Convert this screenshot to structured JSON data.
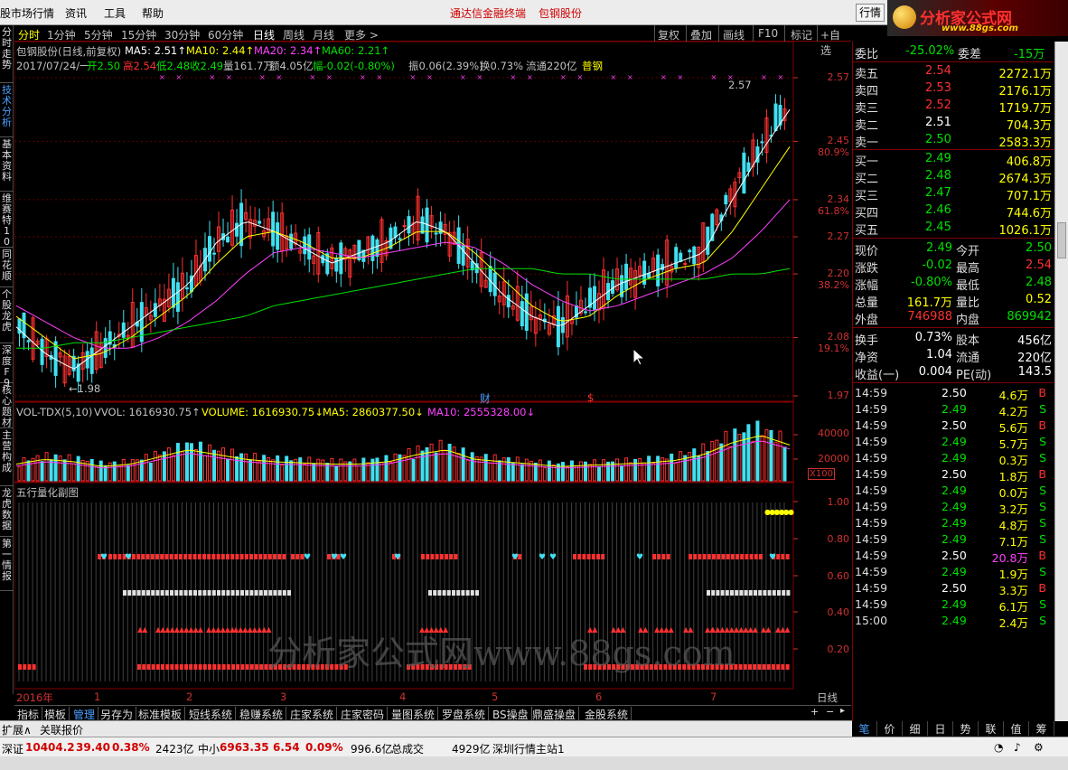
{
  "menubar": {
    "items": [
      "股市场行情",
      "资讯",
      "工具",
      "帮助"
    ],
    "center_title": "通达信金融终端",
    "stock_name": "包钢股份",
    "quote_button": "行情"
  },
  "logo": {
    "name": "分析家公式网",
    "url": "www.88gs.com"
  },
  "left_tabs": [
    "分时走势",
    "技术分析",
    "基本资料",
    "维赛特10",
    "同花顺",
    "个股龙虎",
    "深度F9",
    "核心题材",
    "主营构成",
    "龙虎数据",
    "第一情报"
  ],
  "period_tabs": [
    "分时",
    "1分钟",
    "5分钟",
    "15分钟",
    "30分钟",
    "60分钟",
    "日线",
    "周线",
    "月线",
    "更多 >"
  ],
  "toolbar_buttons": [
    "复权",
    "叠加",
    "画线",
    "F10",
    "标记",
    "+自选"
  ],
  "ma_line": {
    "name": "包钢股份(日线,前复权)",
    "ma5": "MA5: 2.51↑",
    "ma10": "MA10: 2.44↑",
    "ma20": "MA20: 2.34↑",
    "ma60": "MA60: 2.21↑",
    "colors": {
      "ma5": "#ffffff",
      "ma10": "#ffff00",
      "ma20": "#ff40ff",
      "ma60": "#00e000"
    }
  },
  "day_info": {
    "date": "2017/07/24/一",
    "open": "开2.50",
    "high": "高2.54",
    "low": "低2.48",
    "close": "收2.49",
    "vol": "量161.7万",
    "amount": "额4.05亿",
    "change": "幅-0.02(-0.80%)",
    "amplitude": "振0.06(2.39%)",
    "turnover": "换0.73%",
    "float": "流通220亿",
    "tag": "普钢"
  },
  "price_axis": [
    {
      "price": "2.57",
      "pct": ""
    },
    {
      "price": "2.45",
      "pct": "80.9%"
    },
    {
      "price": "2.34",
      "pct": "61.8%"
    },
    {
      "price": "2.27",
      "pct": ""
    },
    {
      "price": "2.20",
      "pct": "38.2%"
    },
    {
      "price": "2.08",
      "pct": "19.1%"
    },
    {
      "price": "1.97",
      "pct": ""
    }
  ],
  "price_annotations": {
    "high": "2.57",
    "low": "1.98",
    "marker1": "财",
    "marker2": "$"
  },
  "vol_line": {
    "name": "VOL-TDX(5,10)",
    "vvol": "VVOL: 1616930.75↑",
    "volume": "VOLUME: 1616930.75↓",
    "ma5": "MA5: 2860377.50↓",
    "ma10": "MA10: 2555328.00↓"
  },
  "vol_axis": [
    "40000",
    "20000"
  ],
  "vol_unit": "X100",
  "wuxing": {
    "title": "五行量化副图",
    "axis": [
      "1.00",
      "0.80",
      "0.60",
      "0.40",
      "0.20"
    ]
  },
  "time_axis": [
    "2016年",
    "1",
    "2",
    "3",
    "4",
    "5",
    "6",
    "7"
  ],
  "period_label": "日线",
  "bottom_tabs": [
    "指标",
    "模板",
    "管理",
    "另存为",
    "标准模板",
    "短线系统",
    "稳赚系统",
    "庄家系统",
    "庄家密码",
    "量图系统",
    "罗盘系统",
    "BS操盘",
    "鼎盛操盘",
    "金股系统"
  ],
  "expand_row": [
    "扩展∧",
    "关联报价"
  ],
  "order_book": {
    "weibi_label": "委比",
    "weibi": "-25.02%",
    "weicha_label": "委差",
    "weicha": "-15万",
    "asks": [
      {
        "label": "卖五",
        "price": "2.54",
        "vol": "2272.1万"
      },
      {
        "label": "卖四",
        "price": "2.53",
        "vol": "2176.1万"
      },
      {
        "label": "卖三",
        "price": "2.52",
        "vol": "1719.7万"
      },
      {
        "label": "卖二",
        "price": "2.51",
        "vol": "704.3万"
      },
      {
        "label": "卖一",
        "price": "2.50",
        "vol": "2583.3万"
      }
    ],
    "bids": [
      {
        "label": "买一",
        "price": "2.49",
        "vol": "406.8万"
      },
      {
        "label": "买二",
        "price": "2.48",
        "vol": "2674.3万"
      },
      {
        "label": "买三",
        "price": "2.47",
        "vol": "707.1万"
      },
      {
        "label": "买四",
        "price": "2.46",
        "vol": "744.6万"
      },
      {
        "label": "买五",
        "price": "2.45",
        "vol": "1026.1万"
      }
    ]
  },
  "stats": [
    {
      "l1": "现价",
      "v1": "2.49",
      "l2": "今开",
      "v2": "2.50"
    },
    {
      "l1": "涨跌",
      "v1": "-0.02",
      "l2": "最高",
      "v2": "2.54"
    },
    {
      "l1": "涨幅",
      "v1": "-0.80%",
      "l2": "最低",
      "v2": "2.48"
    },
    {
      "l1": "总量",
      "v1": "161.7万",
      "l2": "量比",
      "v2": "0.52"
    },
    {
      "l1": "外盘",
      "v1": "746988",
      "l2": "内盘",
      "v2": "869942"
    },
    {
      "l1": "换手",
      "v1": "0.73%",
      "l2": "股本",
      "v2": "456亿"
    },
    {
      "l1": "净资",
      "v1": "1.04",
      "l2": "流通",
      "v2": "220亿"
    },
    {
      "l1": "收益(一)",
      "v1": "0.004",
      "l2": "PE(动)",
      "v2": "143.5"
    }
  ],
  "ticks": [
    {
      "t": "14:59",
      "p": "2.50",
      "v": "4.6万",
      "s": "B"
    },
    {
      "t": "14:59",
      "p": "2.49",
      "v": "4.2万",
      "s": "S"
    },
    {
      "t": "14:59",
      "p": "2.50",
      "v": "5.6万",
      "s": "B"
    },
    {
      "t": "14:59",
      "p": "2.49",
      "v": "5.7万",
      "s": "S"
    },
    {
      "t": "14:59",
      "p": "2.49",
      "v": "0.3万",
      "s": "S"
    },
    {
      "t": "14:59",
      "p": "2.50",
      "v": "1.8万",
      "s": "B"
    },
    {
      "t": "14:59",
      "p": "2.49",
      "v": "0.0万",
      "s": "S"
    },
    {
      "t": "14:59",
      "p": "2.49",
      "v": "3.2万",
      "s": "S"
    },
    {
      "t": "14:59",
      "p": "2.49",
      "v": "4.8万",
      "s": "S"
    },
    {
      "t": "14:59",
      "p": "2.49",
      "v": "7.1万",
      "s": "S"
    },
    {
      "t": "14:59",
      "p": "2.50",
      "v": "20.8万",
      "s": "B"
    },
    {
      "t": "14:59",
      "p": "2.49",
      "v": "1.9万",
      "s": "S"
    },
    {
      "t": "14:59",
      "p": "2.50",
      "v": "3.3万",
      "s": "B"
    },
    {
      "t": "14:59",
      "p": "2.49",
      "v": "6.1万",
      "s": "S"
    },
    {
      "t": "15:00",
      "p": "2.49",
      "v": "2.4万",
      "s": "S"
    }
  ],
  "right_bottom_tabs": [
    "笔",
    "价",
    "细",
    "日",
    "势",
    "联",
    "值",
    "筹"
  ],
  "statusbar": {
    "sz_label": "深证",
    "sz_val": "10404.2",
    "sz_chg": "39.40",
    "sz_pct": "0.38%",
    "sz_amt": "2423亿",
    "zx_label": "中小",
    "zx_val": "6963.35",
    "zx_chg": "6.54",
    "zx_pct": "0.09%",
    "zx_amt": "996.6亿",
    "total_label": "总成交",
    "total_val": "4929亿",
    "server": "深圳行情主站1"
  },
  "watermark": "分析家公式网www.88gs.com",
  "chart_data": {
    "type": "candlestick",
    "price_range": [
      1.97,
      2.57
    ],
    "ma_labels": [
      "MA5",
      "MA10",
      "MA20",
      "MA60"
    ],
    "high": 2.57,
    "low": 1.98,
    "series": [
      {
        "name": "MA5",
        "values": [
          2.1,
          2.05,
          2.02,
          2.06,
          2.1,
          2.14,
          2.18,
          2.26,
          2.3,
          2.28,
          2.25,
          2.22,
          2.24,
          2.26,
          2.3,
          2.28,
          2.22,
          2.16,
          2.12,
          2.1,
          2.14,
          2.18,
          2.2,
          2.22,
          2.24,
          2.34,
          2.43,
          2.51
        ]
      },
      {
        "name": "MA10",
        "values": [
          2.12,
          2.08,
          2.04,
          2.05,
          2.08,
          2.12,
          2.16,
          2.22,
          2.27,
          2.28,
          2.26,
          2.23,
          2.23,
          2.25,
          2.28,
          2.28,
          2.24,
          2.19,
          2.14,
          2.11,
          2.12,
          2.16,
          2.19,
          2.21,
          2.22,
          2.28,
          2.36,
          2.44
        ]
      },
      {
        "name": "MA20",
        "values": [
          2.14,
          2.11,
          2.08,
          2.06,
          2.06,
          2.08,
          2.11,
          2.15,
          2.2,
          2.24,
          2.25,
          2.24,
          2.23,
          2.24,
          2.25,
          2.26,
          2.25,
          2.22,
          2.18,
          2.15,
          2.13,
          2.14,
          2.16,
          2.18,
          2.2,
          2.23,
          2.28,
          2.34
        ]
      },
      {
        "name": "MA60",
        "values": [
          2.06,
          2.06,
          2.07,
          2.07,
          2.08,
          2.09,
          2.1,
          2.11,
          2.12,
          2.14,
          2.15,
          2.16,
          2.17,
          2.18,
          2.19,
          2.2,
          2.21,
          2.21,
          2.21,
          2.2,
          2.2,
          2.19,
          2.19,
          2.19,
          2.19,
          2.2,
          2.2,
          2.21
        ]
      }
    ],
    "volume": [
      14000,
      18000,
      16000,
      12000,
      14000,
      20000,
      26000,
      22000,
      18000,
      16000,
      15000,
      14000,
      14000,
      16000,
      22000,
      26000,
      18000,
      16000,
      14000,
      12000,
      13000,
      14000,
      15000,
      17000,
      22000,
      32000,
      38000,
      30000
    ]
  }
}
